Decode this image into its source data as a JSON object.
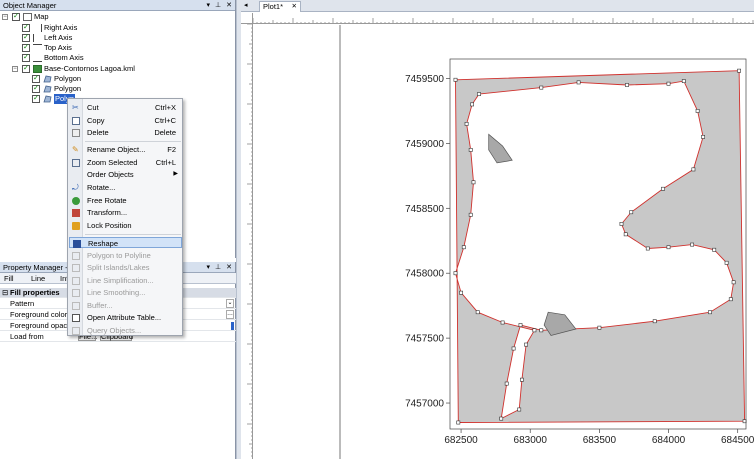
{
  "object_manager": {
    "title": "Object Manager",
    "tree": {
      "map": "Map",
      "right_axis": "Right Axis",
      "left_axis": "Left Axis",
      "top_axis": "Top Axis",
      "bottom_axis": "Bottom Axis",
      "kml": "Base-Contornos Lagoa.kml",
      "polygon1": "Polygon",
      "polygon2": "Polygon",
      "polygon3": "Polyg"
    }
  },
  "property_manager": {
    "title": "Property Manager - M",
    "tabs": {
      "fill": "Fill",
      "line": "Line",
      "info": "Inf"
    },
    "section": "Fill properties",
    "rows": {
      "pattern": "Pattern",
      "fg_color": "Foreground color",
      "fg_opacity": "Foreground opacit",
      "load_from": "Load from"
    },
    "buttons": {
      "file": "File...",
      "clipboard": "Clipboard"
    }
  },
  "context_menu": {
    "cut": "Cut",
    "cut_sc": "Ctrl+X",
    "copy": "Copy",
    "copy_sc": "Ctrl+C",
    "delete": "Delete",
    "delete_sc": "Delete",
    "rename": "Rename Object...",
    "rename_sc": "F2",
    "zoom": "Zoom Selected",
    "zoom_sc": "Ctrl+L",
    "order": "Order Objects",
    "rotate": "Rotate...",
    "free_rotate": "Free Rotate",
    "transform": "Transform...",
    "lock": "Lock Position",
    "reshape": "Reshape",
    "poly_to_line": "Polygon to Polyline",
    "split": "Split Islands/Lakes",
    "line_simp": "Line Simplification...",
    "line_smooth": "Line Smoothing...",
    "buffer": "Buffer...",
    "open_attr": "Open Attribute Table...",
    "query": "Query Objects..."
  },
  "plot_tab": {
    "label": "Plot1*",
    "close": "✕",
    "nav": "◂"
  },
  "colors": {
    "fill": "#c8c8c8",
    "outline": "#d0312d",
    "highlight": "#d2e3f8",
    "selection": "#2a62c9"
  },
  "chart_data": {
    "type": "map",
    "x_ticks": [
      "682500",
      "683000",
      "683500",
      "684000",
      "684500"
    ],
    "y_ticks": [
      "7459500",
      "7459000",
      "7458500",
      "7458000",
      "7457500",
      "7457000"
    ],
    "xlim": [
      682420,
      684560
    ],
    "ylim": [
      7456800,
      7459650
    ],
    "outer_boundary": [
      [
        682460,
        7459490
      ],
      [
        684510,
        7459560
      ],
      [
        684550,
        7456860
      ],
      [
        682480,
        7456850
      ]
    ],
    "lagoon_hole": [
      [
        682630,
        7459380
      ],
      [
        683080,
        7459430
      ],
      [
        683350,
        7459470
      ],
      [
        683700,
        7459450
      ],
      [
        684000,
        7459460
      ],
      [
        684110,
        7459480
      ],
      [
        684210,
        7459250
      ],
      [
        684250,
        7459050
      ],
      [
        684180,
        7458800
      ],
      [
        683960,
        7458650
      ],
      [
        683730,
        7458470
      ],
      [
        683660,
        7458380
      ],
      [
        683690,
        7458300
      ],
      [
        683850,
        7458190
      ],
      [
        684000,
        7458200
      ],
      [
        684170,
        7458220
      ],
      [
        684330,
        7458180
      ],
      [
        684420,
        7458080
      ],
      [
        684470,
        7457930
      ],
      [
        684450,
        7457800
      ],
      [
        684300,
        7457700
      ],
      [
        683900,
        7457630
      ],
      [
        683500,
        7457580
      ],
      [
        683080,
        7457560
      ],
      [
        682930,
        7457600
      ],
      [
        682880,
        7457420
      ],
      [
        682830,
        7457150
      ],
      [
        682790,
        7456880
      ],
      [
        682920,
        7456950
      ],
      [
        682940,
        7457180
      ],
      [
        682970,
        7457450
      ],
      [
        683030,
        7457560
      ],
      [
        682800,
        7457620
      ],
      [
        682620,
        7457700
      ],
      [
        682500,
        7457850
      ],
      [
        682460,
        7458000
      ],
      [
        682520,
        7458200
      ],
      [
        682570,
        7458450
      ],
      [
        682590,
        7458700
      ],
      [
        682570,
        7458950
      ],
      [
        682540,
        7459150
      ],
      [
        682580,
        7459300
      ]
    ],
    "islands": [
      [
        [
          682700,
          7459070
        ],
        [
          682800,
          7458980
        ],
        [
          682870,
          7458870
        ],
        [
          682760,
          7458850
        ],
        [
          682700,
          7458950
        ]
      ],
      [
        [
          683130,
          7457700
        ],
        [
          683250,
          7457680
        ],
        [
          683330,
          7457570
        ],
        [
          683150,
          7457520
        ],
        [
          683100,
          7457600
        ]
      ]
    ]
  }
}
